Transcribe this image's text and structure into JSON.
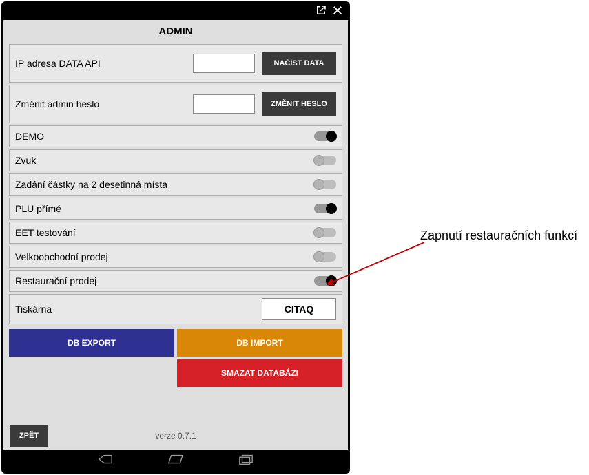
{
  "header": {
    "title": "ADMIN"
  },
  "rows": {
    "ip": {
      "label": "IP adresa DATA API",
      "value": "",
      "button": "NAČÍST DATA"
    },
    "pass": {
      "label": "Změnit admin heslo",
      "value": "",
      "button": "ZMĚNIT HESLO"
    },
    "demo": {
      "label": "DEMO",
      "on": true
    },
    "zvuk": {
      "label": "Zvuk",
      "on": false
    },
    "castka": {
      "label": "Zadání částky na 2 desetinná místa",
      "on": false
    },
    "plu": {
      "label": "PLU přímé",
      "on": true
    },
    "eet": {
      "label": "EET testování",
      "on": false
    },
    "velko": {
      "label": "Velkoobchodní prodej",
      "on": false
    },
    "rest": {
      "label": "Restaurační prodej",
      "on": true
    },
    "printer": {
      "label": "Tiskárna",
      "value": "CITAQ"
    }
  },
  "buttons": {
    "export": "DB EXPORT",
    "import": "DB IMPORT",
    "delete": "SMAZAT DATABÁZI",
    "back": "ZPĚT"
  },
  "footer": {
    "version": "verze 0.7.1"
  },
  "annotation": {
    "text": "Zapnutí restauračních funkcí"
  }
}
